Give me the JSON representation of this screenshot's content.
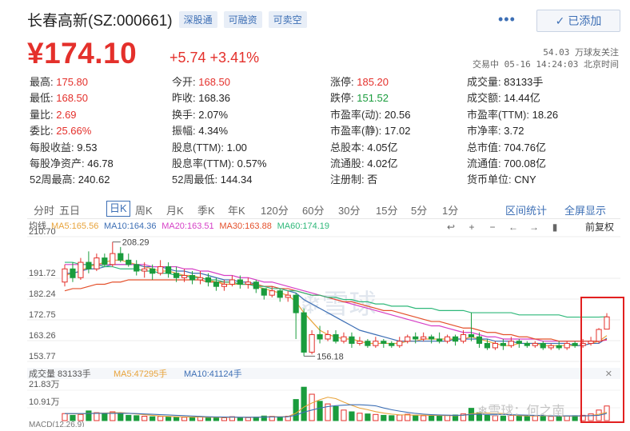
{
  "header": {
    "stock_name": "长春高新(SZ:000661)",
    "badges": [
      "深股通",
      "可融资",
      "可卖空"
    ],
    "add_button_label": "已添加"
  },
  "price": {
    "current": "¥174.10",
    "change": "+5.74 +3.41%",
    "followers": "54.03 万球友关注",
    "time_info": "交易中 05-16 14:24:03 北京时间"
  },
  "quote": {
    "rows": [
      [
        {
          "label": "最高:",
          "value": "175.80",
          "color": "up"
        },
        {
          "label": "今开:",
          "value": "168.50",
          "color": "up"
        },
        {
          "label": "涨停:",
          "value": "185.20",
          "color": "up"
        },
        {
          "label": "成交量:",
          "value": "83133手",
          "color": "normal"
        }
      ],
      [
        {
          "label": "最低:",
          "value": "168.50",
          "color": "up"
        },
        {
          "label": "昨收:",
          "value": "168.36",
          "color": "normal"
        },
        {
          "label": "跌停:",
          "value": "151.52",
          "color": "down"
        },
        {
          "label": "成交额:",
          "value": "14.44亿",
          "color": "normal"
        }
      ],
      [
        {
          "label": "量比:",
          "value": "2.69",
          "color": "up"
        },
        {
          "label": "换手:",
          "value": "2.07%",
          "color": "normal"
        },
        {
          "label": "市盈率(动):",
          "value": "20.56",
          "color": "normal"
        },
        {
          "label": "市盈率(TTM):",
          "value": "18.26",
          "color": "normal"
        }
      ],
      [
        {
          "label": "委比:",
          "value": "25.66%",
          "color": "up"
        },
        {
          "label": "振幅:",
          "value": "4.34%",
          "color": "normal"
        },
        {
          "label": "市盈率(静):",
          "value": "17.02",
          "color": "normal"
        },
        {
          "label": "市净率:",
          "value": "3.72",
          "color": "normal"
        }
      ],
      [
        {
          "label": "每股收益:",
          "value": "9.53",
          "color": "normal"
        },
        {
          "label": "股息(TTM):",
          "value": "1.00",
          "color": "normal"
        },
        {
          "label": "总股本:",
          "value": "4.05亿",
          "color": "normal"
        },
        {
          "label": "总市值:",
          "value": "704.76亿",
          "color": "normal"
        }
      ],
      [
        {
          "label": "每股净资产:",
          "value": "46.78",
          "color": "normal"
        },
        {
          "label": "股息率(TTM):",
          "value": "0.57%",
          "color": "normal"
        },
        {
          "label": "流通股:",
          "value": "4.02亿",
          "color": "normal"
        },
        {
          "label": "流通值:",
          "value": "700.08亿",
          "color": "normal"
        }
      ],
      [
        {
          "label": "52周最高:",
          "value": "240.62",
          "color": "normal"
        },
        {
          "label": "52周最低:",
          "value": "144.34",
          "color": "normal"
        },
        {
          "label": "注册制:",
          "value": "否",
          "color": "normal"
        },
        {
          "label": "货币单位:",
          "value": "CNY",
          "color": "normal"
        }
      ]
    ]
  },
  "tabs": {
    "items": [
      "分时",
      "五日",
      "日K",
      "周K",
      "月K",
      "季K",
      "年K",
      "120分",
      "60分",
      "30分",
      "15分",
      "5分",
      "1分"
    ],
    "active": 2,
    "right": [
      "区间统计",
      "全屏显示"
    ]
  },
  "chart_data": {
    "type": "candlestick",
    "legend_label": "均线",
    "ma_labels": [
      {
        "text": "MA5:165.56",
        "color": "#e8a33a"
      },
      {
        "text": "MA10:164.36",
        "color": "#3d6fb5"
      },
      {
        "text": "MA20:163.51",
        "color": "#d63fc6"
      },
      {
        "text": "MA30:163.88",
        "color": "#e4502b"
      },
      {
        "text": "MA60:174.19",
        "color": "#2fb87a"
      }
    ],
    "adjust_label": "前复权",
    "yticks": [
      "210.70",
      "191.72",
      "182.24",
      "172.75",
      "163.26",
      "153.77"
    ],
    "ylim": [
      153.77,
      210.7
    ],
    "max_label": "208.29",
    "min_label": "156.18",
    "candles": [
      [
        190,
        196,
        188,
        198
      ],
      [
        196,
        192,
        190,
        199
      ],
      [
        192,
        199,
        191,
        201
      ],
      [
        199,
        196,
        194,
        204
      ],
      [
        196,
        201,
        195,
        203
      ],
      [
        201,
        198,
        197,
        203
      ],
      [
        198,
        203,
        197,
        208.29
      ],
      [
        203,
        200,
        199,
        206
      ],
      [
        200,
        198,
        197,
        203
      ],
      [
        198,
        195,
        193,
        200
      ],
      [
        195,
        196,
        192,
        199
      ],
      [
        196,
        194,
        191,
        198
      ],
      [
        194,
        197,
        193,
        200
      ],
      [
        197,
        194,
        192,
        199
      ],
      [
        194,
        192,
        190,
        197
      ],
      [
        192,
        193,
        190,
        196
      ],
      [
        193,
        191,
        189,
        195
      ],
      [
        191,
        192,
        189,
        195
      ],
      [
        192,
        190,
        188,
        194
      ],
      [
        190,
        188,
        186,
        192
      ],
      [
        188,
        189,
        186,
        191
      ],
      [
        189,
        191,
        188,
        193
      ],
      [
        191,
        189,
        187,
        193
      ],
      [
        189,
        190,
        187,
        192
      ],
      [
        190,
        187,
        185,
        191
      ],
      [
        187,
        184,
        182,
        186
      ],
      [
        184,
        186,
        183,
        188
      ],
      [
        186,
        183,
        181,
        187
      ],
      [
        183,
        184,
        181,
        186
      ],
      [
        184,
        176,
        164,
        185
      ],
      [
        176,
        158,
        156.18,
        178
      ],
      [
        158,
        166,
        157,
        168
      ],
      [
        166,
        164,
        162,
        170
      ],
      [
        164,
        166,
        163,
        168
      ],
      [
        166,
        163,
        162,
        168
      ],
      [
        163,
        165,
        162,
        167
      ],
      [
        165,
        162,
        160,
        167
      ],
      [
        162,
        163,
        161,
        165
      ],
      [
        163,
        161,
        160,
        164
      ],
      [
        161,
        163,
        160,
        165
      ],
      [
        163,
        162,
        160,
        164
      ],
      [
        162,
        161,
        160,
        163
      ],
      [
        161,
        163,
        160,
        165
      ],
      [
        163,
        165,
        162,
        166
      ],
      [
        165,
        164,
        162,
        167
      ],
      [
        164,
        165,
        163,
        167
      ],
      [
        165,
        164,
        162,
        166
      ],
      [
        164,
        163,
        162,
        167
      ],
      [
        163,
        165,
        162,
        166
      ],
      [
        165,
        163,
        161,
        166
      ],
      [
        163,
        166,
        162,
        168
      ],
      [
        166,
        165,
        163,
        176
      ],
      [
        165,
        162,
        160,
        167
      ],
      [
        162,
        160,
        159,
        164
      ],
      [
        160,
        162,
        159,
        163
      ],
      [
        162,
        161,
        159,
        164
      ],
      [
        161,
        163,
        160,
        165
      ],
      [
        163,
        162,
        160,
        164
      ],
      [
        162,
        161,
        160,
        163
      ],
      [
        161,
        162,
        160,
        163
      ],
      [
        162,
        160,
        159,
        163
      ],
      [
        160,
        161,
        159,
        162
      ],
      [
        161,
        160,
        159,
        163
      ],
      [
        160,
        162,
        159,
        163
      ],
      [
        162,
        161,
        160,
        163
      ],
      [
        161,
        162,
        160,
        164
      ],
      [
        162,
        163,
        161,
        165
      ],
      [
        163,
        168.36,
        162,
        169
      ],
      [
        168.5,
        174.1,
        168.5,
        175.8
      ]
    ],
    "ma_lines": {
      "ma5": [
        193,
        194,
        195,
        197,
        198,
        199,
        200,
        200,
        199,
        198,
        197,
        196,
        195,
        195,
        194,
        193,
        193,
        192,
        191,
        190,
        189,
        189,
        189,
        189,
        188,
        187,
        186,
        185,
        184,
        181,
        176,
        172,
        168,
        166,
        165,
        164,
        164,
        163,
        162,
        162,
        162,
        162,
        162,
        163,
        163,
        164,
        164,
        164,
        164,
        164,
        164,
        165,
        164,
        163,
        162,
        161,
        161,
        162,
        162,
        162,
        161,
        161,
        161,
        161,
        161,
        161,
        162,
        163,
        165.56
      ],
      "ma10": [
        194,
        194,
        195,
        196,
        196,
        197,
        198,
        198,
        198,
        198,
        197,
        197,
        197,
        196,
        195,
        195,
        194,
        194,
        193,
        192,
        191,
        191,
        190,
        190,
        189,
        188,
        188,
        187,
        186,
        185,
        182,
        180,
        178,
        176,
        174,
        172,
        170,
        168,
        167,
        166,
        165,
        164,
        163,
        163,
        163,
        163,
        163,
        163,
        163,
        164,
        164,
        164,
        164,
        164,
        163,
        163,
        163,
        162,
        162,
        162,
        162,
        162,
        162,
        162,
        161,
        161,
        162,
        162,
        164.36
      ],
      "ma20": [
        198,
        198,
        198,
        198,
        198,
        198,
        198,
        198,
        198,
        198,
        198,
        197,
        197,
        197,
        197,
        196,
        196,
        195,
        195,
        194,
        193,
        193,
        192,
        192,
        191,
        190,
        190,
        189,
        188,
        187,
        186,
        185,
        184,
        183,
        182,
        181,
        180,
        179,
        178,
        177,
        176,
        175,
        174,
        173,
        172,
        171,
        170,
        170,
        169,
        168,
        167,
        167,
        166,
        165,
        165,
        164,
        164,
        164,
        164,
        164,
        163,
        163,
        163,
        163,
        163,
        163,
        163,
        163,
        163.51
      ],
      "ma30": [
        186,
        187,
        187,
        188,
        189,
        189,
        190,
        190,
        191,
        191,
        191,
        191,
        191,
        191,
        191,
        191,
        191,
        191,
        190,
        190,
        190,
        190,
        189,
        189,
        189,
        188,
        188,
        187,
        187,
        186,
        185,
        184,
        184,
        183,
        182,
        181,
        181,
        180,
        179,
        178,
        177,
        177,
        176,
        175,
        174,
        173,
        172,
        172,
        171,
        170,
        169,
        169,
        168,
        167,
        167,
        166,
        166,
        165,
        165,
        164,
        164,
        164,
        163,
        163,
        163,
        163,
        163,
        163,
        163.88
      ],
      "ma60": [
        199,
        199,
        198,
        198,
        198,
        197,
        197,
        196,
        196,
        196,
        195,
        195,
        194,
        194,
        193,
        193,
        192,
        192,
        191,
        191,
        190,
        190,
        189,
        189,
        188,
        188,
        187,
        187,
        186,
        186,
        185,
        184,
        184,
        183,
        183,
        182,
        182,
        181,
        181,
        180,
        180,
        179,
        179,
        179,
        178,
        178,
        178,
        177,
        177,
        177,
        177,
        176,
        176,
        176,
        176,
        176,
        176,
        175,
        175,
        175,
        175,
        175,
        175,
        174,
        174,
        174,
        174,
        174,
        174.19
      ]
    },
    "volume_title": "成交量 83133手",
    "volume_ma_labels": [
      {
        "text": "MA5:47295手",
        "color": "#e8a33a"
      },
      {
        "text": "MA10:41124手",
        "color": "#3d6fb5"
      }
    ],
    "volume_yticks": [
      "21.83万",
      "10.91万"
    ],
    "volume_max": 218300,
    "volumes": [
      40000,
      30000,
      35000,
      55000,
      45000,
      38000,
      50000,
      42000,
      30000,
      28000,
      25000,
      22000,
      24000,
      20000,
      18000,
      19000,
      17000,
      21000,
      19000,
      18000,
      16000,
      22000,
      18000,
      17000,
      20000,
      26000,
      24000,
      21000,
      25000,
      120000,
      190000,
      150000,
      110000,
      95000,
      80000,
      60000,
      50000,
      42000,
      38000,
      35000,
      30000,
      28000,
      32000,
      36000,
      30000,
      28000,
      26000,
      25000,
      30000,
      32000,
      38000,
      70000,
      45000,
      30000,
      28000,
      26000,
      30000,
      27000,
      25000,
      26000,
      30000,
      24000,
      22000,
      26000,
      28000,
      30000,
      38000,
      60000,
      83133
    ],
    "volume_ma5": [
      40000,
      39000,
      38000,
      41000,
      42000,
      43000,
      44000,
      46000,
      42000,
      38000,
      34000,
      30000,
      26000,
      24000,
      22000,
      21000,
      20000,
      20000,
      19000,
      19000,
      18000,
      19000,
      19000,
      19000,
      19000,
      21000,
      22000,
      22000,
      23000,
      42000,
      77000,
      100000,
      119000,
      133000,
      125000,
      105000,
      87000,
      71000,
      62000,
      51000,
      43000,
      37000,
      33000,
      32000,
      31000,
      31000,
      30000,
      29000,
      28000,
      28000,
      30000,
      39000,
      43000,
      43000,
      42000,
      40000,
      32000,
      28000,
      27000,
      27000,
      28000,
      26000,
      25000,
      25000,
      26000,
      26000,
      28000,
      36000,
      47295
    ],
    "volume_ma10": [
      40000,
      40000,
      40000,
      40000,
      41000,
      41000,
      41000,
      42000,
      41000,
      40000,
      38000,
      36000,
      34000,
      32000,
      30000,
      28000,
      26000,
      24000,
      22000,
      21000,
      20000,
      20000,
      19000,
      19000,
      19000,
      20000,
      21000,
      21000,
      22000,
      31000,
      48000,
      60000,
      71000,
      80000,
      85000,
      88000,
      90000,
      90000,
      88000,
      84000,
      72000,
      62000,
      54000,
      47000,
      41000,
      37000,
      34000,
      32000,
      31000,
      30000,
      31000,
      35000,
      36000,
      35000,
      35000,
      35000,
      34000,
      32000,
      31000,
      30000,
      29000,
      27000,
      27000,
      27000,
      27000,
      27000,
      28000,
      30000,
      41124
    ],
    "macd_label": "MACD(12,26,9)"
  }
}
